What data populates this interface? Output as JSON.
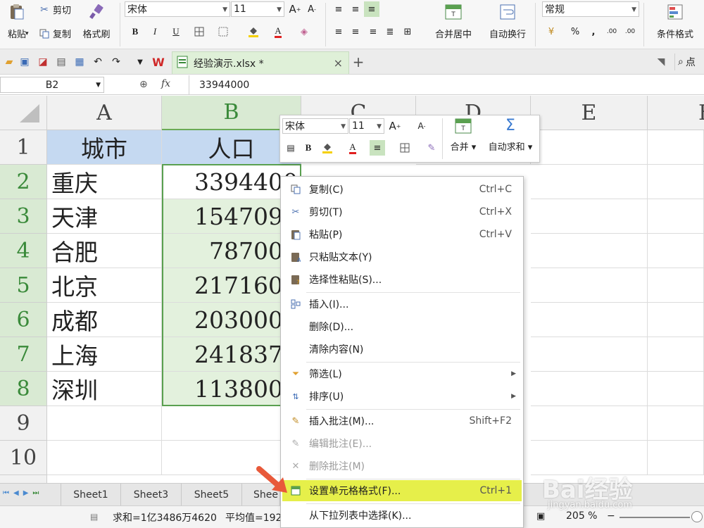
{
  "ribbon": {
    "paste_label": "粘贴",
    "cut_label": "剪切",
    "copy_label": "复制",
    "format_painter_label": "格式刷",
    "font_name": "宋体",
    "font_size": "11",
    "bold": "B",
    "italic": "I",
    "underline": "U",
    "grow_font": "A",
    "shrink_font": "A",
    "font_color_letter": "A",
    "merge_center_label": "合并居中",
    "wrap_text_label": "自动换行",
    "number_format": "常规",
    "percent": "%",
    "comma": ",",
    "inc_decimal": ".00",
    "dec_decimal": ".00",
    "conditional_format_label": "条件格式",
    "colors": {
      "font_red": "#e02020",
      "fill_yellow": "#f5d000",
      "accent_green": "#3a8a3a"
    }
  },
  "tabbar": {
    "doc_name": "经验演示.xlsx *",
    "close": "×",
    "new_tab": "+",
    "search_label": "点"
  },
  "formula_bar": {
    "cell_ref": "B2",
    "fx": "fx",
    "value": "33944000"
  },
  "grid": {
    "columns": [
      "A",
      "B",
      "C",
      "D",
      "E",
      "F"
    ],
    "rows": [
      "1",
      "2",
      "3",
      "4",
      "5",
      "6",
      "7",
      "8",
      "9",
      "10"
    ],
    "header_row": {
      "a": "城市",
      "b": "人口"
    },
    "data": [
      {
        "city": "重庆",
        "population": "3394400"
      },
      {
        "city": "天津",
        "population": "1547092"
      },
      {
        "city": "合肥",
        "population": "787000"
      },
      {
        "city": "北京",
        "population": "2171600"
      },
      {
        "city": "成都",
        "population": "2030000"
      },
      {
        "city": "上海",
        "population": "2418370"
      },
      {
        "city": "深圳",
        "population": "1138000"
      }
    ]
  },
  "mini_toolbar": {
    "font_name": "宋体",
    "font_size": "11",
    "bold": "B",
    "grow": "A",
    "shrink": "A",
    "color_letter": "A",
    "merge_label": "合并",
    "autosum_label": "自动求和"
  },
  "context_menu": {
    "items": [
      {
        "label": "复制(C)",
        "shortcut": "Ctrl+C"
      },
      {
        "label": "剪切(T)",
        "shortcut": "Ctrl+X"
      },
      {
        "label": "粘贴(P)",
        "shortcut": "Ctrl+V"
      },
      {
        "label": "只粘贴文本(Y)",
        "shortcut": ""
      },
      {
        "label": "选择性粘贴(S)...",
        "shortcut": ""
      },
      {
        "label": "插入(I)...",
        "shortcut": ""
      },
      {
        "label": "删除(D)...",
        "shortcut": ""
      },
      {
        "label": "清除内容(N)",
        "shortcut": ""
      },
      {
        "label": "筛选(L)",
        "shortcut": ""
      },
      {
        "label": "排序(U)",
        "shortcut": ""
      },
      {
        "label": "插入批注(M)...",
        "shortcut": "Shift+F2"
      },
      {
        "label": "编辑批注(E)...",
        "shortcut": ""
      },
      {
        "label": "删除批注(M)",
        "shortcut": ""
      },
      {
        "label": "设置单元格格式(F)...",
        "shortcut": "Ctrl+1"
      },
      {
        "label": "从下拉列表中选择(K)...",
        "shortcut": ""
      }
    ],
    "highlight_color": "#e6ef4a"
  },
  "sheets": {
    "tabs": [
      "Sheet1",
      "Sheet3",
      "Sheet5",
      "Shee"
    ]
  },
  "status": {
    "sum": "求和=1亿3486万4620",
    "average": "平均值=192",
    "zoom": "205 %"
  },
  "watermark": {
    "brand": "Bai经验",
    "url": "jingyan.baidu.com"
  }
}
